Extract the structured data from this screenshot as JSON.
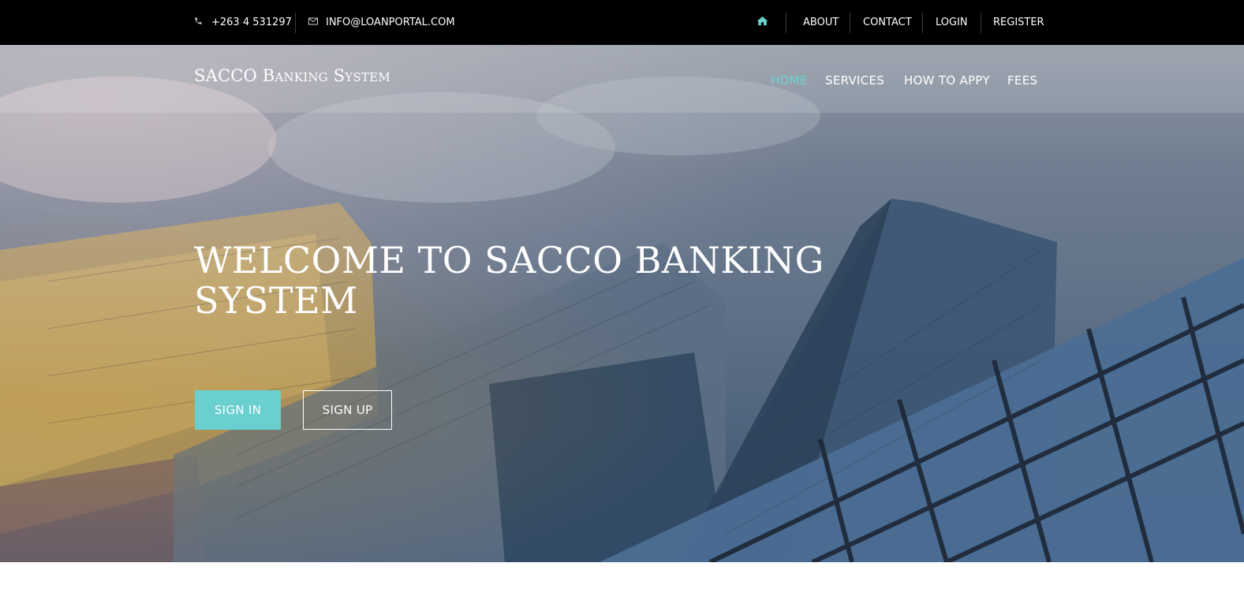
{
  "topbar": {
    "phone": "+263 4 531297",
    "email": "INFO@LOANPORTAL.COM",
    "links": [
      "ABOUT",
      "CONTACT",
      "LOGIN",
      "REGISTER"
    ]
  },
  "navbar": {
    "brand_first": "SACCO",
    "brand_second": "Banking System",
    "menu": [
      "HOME",
      "SERVICES",
      "HOW TO APPY",
      "FEES"
    ]
  },
  "hero": {
    "headline_line1": "WELCOME TO SACCO BANKING",
    "headline_line2": "SYSTEM",
    "signin_label": "SIGN IN",
    "signup_label": "SIGN UP"
  },
  "colors": {
    "accent": "#6ad0cf",
    "topbar_bg": "#000000"
  },
  "icons": [
    "phone-icon",
    "envelope-icon",
    "home-icon"
  ]
}
